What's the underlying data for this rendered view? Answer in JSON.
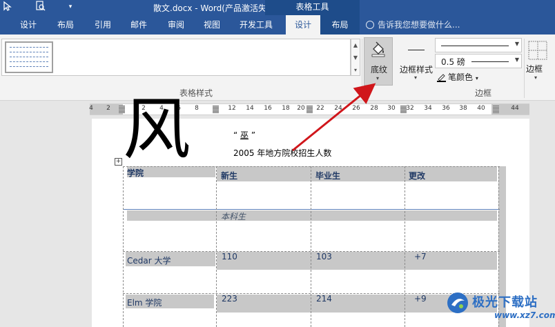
{
  "app": {
    "window_title": "散文.docx - Word(产品激活失败)",
    "contextual_header": "表格工具"
  },
  "tabs": [
    {
      "label": "设计"
    },
    {
      "label": "布局"
    },
    {
      "label": "引用"
    },
    {
      "label": "邮件"
    },
    {
      "label": "审阅"
    },
    {
      "label": "视图"
    },
    {
      "label": "开发工具"
    },
    {
      "label": "设计"
    },
    {
      "label": "布局"
    }
  ],
  "tell_me": {
    "placeholder": "告诉我您想要做什么..."
  },
  "ribbon": {
    "table_styles_group": "表格样式",
    "shading_label": "底纹",
    "border_styles_label": "边框样式",
    "pen_weight": "0.5 磅",
    "pen_color_label": "笔颜色",
    "borders_label": "边框",
    "borders_group": "边框",
    "accent_color": "#2b579a",
    "shading_icon": "paint-bucket-icon"
  },
  "ruler": {
    "numbers": [
      "4",
      "2",
      "2",
      "4",
      "6",
      "8",
      "12",
      "14",
      "16",
      "18",
      "20",
      "22",
      "24",
      "26",
      "28",
      "30",
      "32",
      "34",
      "36",
      "38",
      "40",
      "44"
    ]
  },
  "document": {
    "big_glyph": "风",
    "quote_prefix": "“",
    "quote_word": "巫",
    "quote_suffix": "”",
    "table_caption": "2005 年地方院校招生人数",
    "table": {
      "headers": [
        "学院",
        "新生",
        "毕业生",
        "更改"
      ],
      "subheader": "本科生",
      "rows": [
        {
          "name": "Cedar 大学",
          "new": "110",
          "grad": "103",
          "change": "+7"
        },
        {
          "name": "Elm 学院",
          "new": "223",
          "grad": "214",
          "change": "+9"
        }
      ]
    }
  },
  "watermark": {
    "text": "极光下载站",
    "url": "www.xz7.com"
  }
}
